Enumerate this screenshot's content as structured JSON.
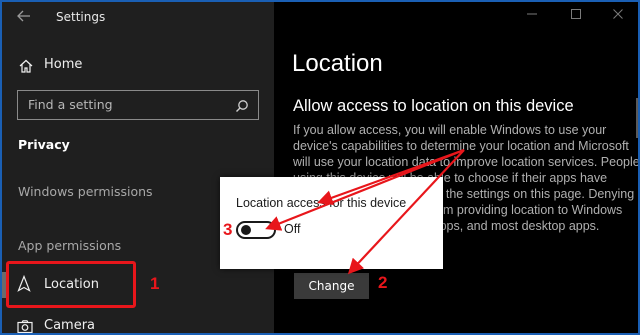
{
  "window": {
    "app_title": "Settings",
    "back_icon": "back-arrow-icon",
    "controls": [
      "minimize-icon",
      "maximize-icon",
      "close-icon"
    ]
  },
  "sidebar": {
    "home_label": "Home",
    "search_placeholder": "Find a setting",
    "category": "Privacy",
    "windows_permissions": "Windows permissions",
    "app_permissions": "App permissions",
    "location_label": "Location",
    "camera_label": "Camera"
  },
  "main": {
    "page_title": "Location",
    "section_heading": "Allow access to location on this device",
    "body_lines": [
      "If you allow access, you will enable Windows to use your",
      "device's capabilities to determine your location and Microsoft",
      "will use your location data to improve location services. People",
      "using this device will be able to choose if their apps have",
      "access to location by using the settings on this page. Denying",
      "access blocks Windows from providing location to Windows",
      "features, Microsoft Store apps, and most desktop apps."
    ],
    "change_button": "Change"
  },
  "popup": {
    "title": "Location access for this device",
    "toggle_state": "Off",
    "toggle_on": false
  },
  "annotations": {
    "callout_1": "1",
    "callout_2": "2",
    "callout_3": "3",
    "color": "#e8161b"
  }
}
